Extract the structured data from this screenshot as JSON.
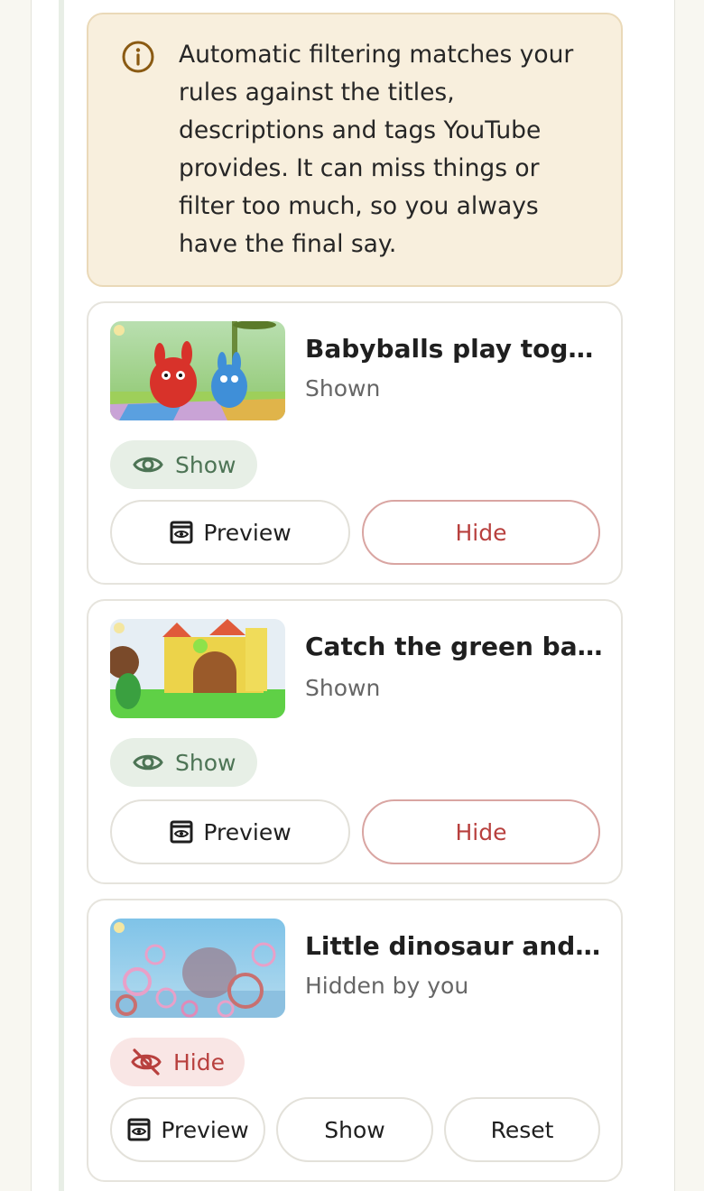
{
  "notice": {
    "icon": "info-icon",
    "text": "Automatic filtering matches your rules against the titles, descriptions and tags YouTube provides. It can miss things or filter too much, so you always have the final say."
  },
  "videos": [
    {
      "title": "Babyballs play toge…",
      "status": "Shown",
      "chip_label": "Show",
      "chip_icon": "eye-icon",
      "preview_label": "Preview",
      "action_label": "Hide"
    },
    {
      "title": "Catch the green bal…",
      "status": "Shown",
      "chip_label": "Show",
      "chip_icon": "eye-icon",
      "preview_label": "Preview",
      "action_label": "Hide"
    },
    {
      "title": "Little dinosaur and …",
      "status": "Hidden by you",
      "chip_label": "Hide",
      "chip_icon": "eye-off-icon",
      "preview_label": "Preview",
      "show_label": "Show",
      "reset_label": "Reset"
    }
  ],
  "colors": {
    "notice_bg": "#f8efdd",
    "show_chip_bg": "#e7efe6",
    "show_chip_text": "#4d7455",
    "hide_chip_bg": "#f9e6e5",
    "hide_text": "#b8403e"
  }
}
